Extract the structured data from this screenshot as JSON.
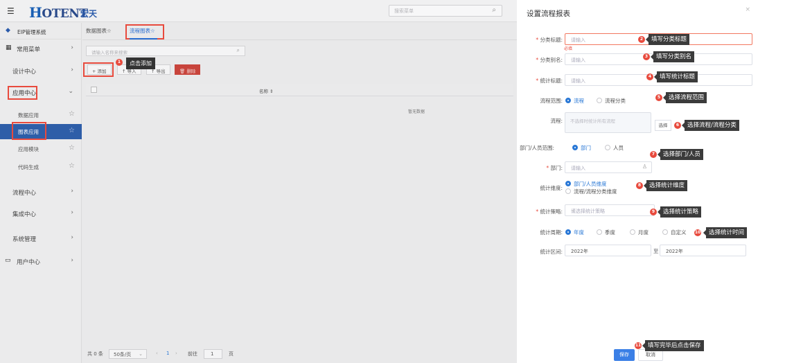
{
  "app": {
    "menu_icon": "☰",
    "logo_mark": "H",
    "logo_text": "OTENT",
    "logo_cn": "宏天",
    "top_search_placeholder": "搜索菜单",
    "search_icon": "⌕"
  },
  "sidebar": {
    "header_label": "EIP管理系统",
    "items": [
      {
        "label": "常用菜单",
        "arrow": "›"
      },
      {
        "label": "设计中心",
        "arrow": "›"
      },
      {
        "label": "应用中心",
        "arrow": "⌄"
      },
      {
        "label": "流程中心",
        "arrow": "›"
      },
      {
        "label": "集成中心",
        "arrow": "›"
      },
      {
        "label": "系统管理",
        "arrow": "›"
      },
      {
        "label": "用户中心",
        "arrow": "›"
      }
    ],
    "sub_items": [
      {
        "label": "数据应用",
        "star": "☆"
      },
      {
        "label": "图表应用",
        "star": "☆"
      },
      {
        "label": "应用模块",
        "star": "☆"
      },
      {
        "label": "代码生成",
        "star": "☆"
      }
    ]
  },
  "main": {
    "tabs": [
      {
        "label": "数据图表☆"
      },
      {
        "label": "流程图表☆"
      }
    ],
    "list_search_placeholder": "请输入名称来搜索",
    "toolbar": {
      "add": "+ 添加",
      "import": "↑ 导入",
      "export": "↑ 导出",
      "delete": "🗑 删除"
    },
    "tooltip_add": "点击添加",
    "table": {
      "col_name": "名称 ⇕",
      "empty": "暂无数据"
    },
    "pager": {
      "total": "共 0 条",
      "page_size": "50条/页",
      "prev": "‹",
      "page": "1",
      "next": "›",
      "goto": "前往",
      "goto_page": "1",
      "unit": "页"
    }
  },
  "drawer": {
    "title": "设置流程报表",
    "close": "×",
    "fields": {
      "category_title": {
        "label": "分类标题:",
        "placeholder": "请输入",
        "error": "必填"
      },
      "category_alias": {
        "label": "分类别名:",
        "placeholder": "请输入"
      },
      "stat_title": {
        "label": "统计标题:",
        "placeholder": "请输入"
      },
      "process_scope": {
        "label": "流程范围:",
        "opt1": "流程",
        "opt2": "流程分类"
      },
      "process": {
        "label": "流程:",
        "placeholder": "不选择时统计所有流程",
        "btn": "选择"
      },
      "dept_scope": {
        "label": "部门/人员范围:",
        "opt1": "部门",
        "opt2": "人员"
      },
      "dept": {
        "label": "部门:",
        "placeholder": "请输入"
      },
      "stat_dim": {
        "label": "统计维度:",
        "opt1": "部门/人员维度",
        "opt2": "流程/流程分类维度"
      },
      "stat_strategy": {
        "label": "统计策略:",
        "placeholder": "请选择统计策略"
      },
      "stat_period": {
        "label": "统计周期:",
        "opt1": "年度",
        "opt2": "季度",
        "opt3": "月度",
        "opt4": "自定义"
      },
      "stat_range": {
        "label": "统计区间:",
        "from": "2022年",
        "to_label": "至",
        "to": "2022年"
      }
    },
    "save": "保存",
    "cancel": "取消"
  },
  "annotations": [
    {
      "num": "1",
      "text": "点击添加"
    },
    {
      "num": "2",
      "text": "填写分类标题"
    },
    {
      "num": "3",
      "text": "填写分类别名"
    },
    {
      "num": "4",
      "text": "填写统计标题"
    },
    {
      "num": "5",
      "text": "选择流程范围"
    },
    {
      "num": "6",
      "text": "选择流程/流程分类"
    },
    {
      "num": "7",
      "text": "选择部门/人员"
    },
    {
      "num": "8",
      "text": "选择统计维度"
    },
    {
      "num": "9",
      "text": "选择统计策略"
    },
    {
      "num": "10",
      "text": "选择统计时间"
    },
    {
      "num": "11",
      "text": "填写完毕后点击保存"
    }
  ],
  "colors": {
    "primary": "#2a78d6",
    "highlight": "#e84a3d",
    "sidebar_active": "#2e5ea8"
  }
}
